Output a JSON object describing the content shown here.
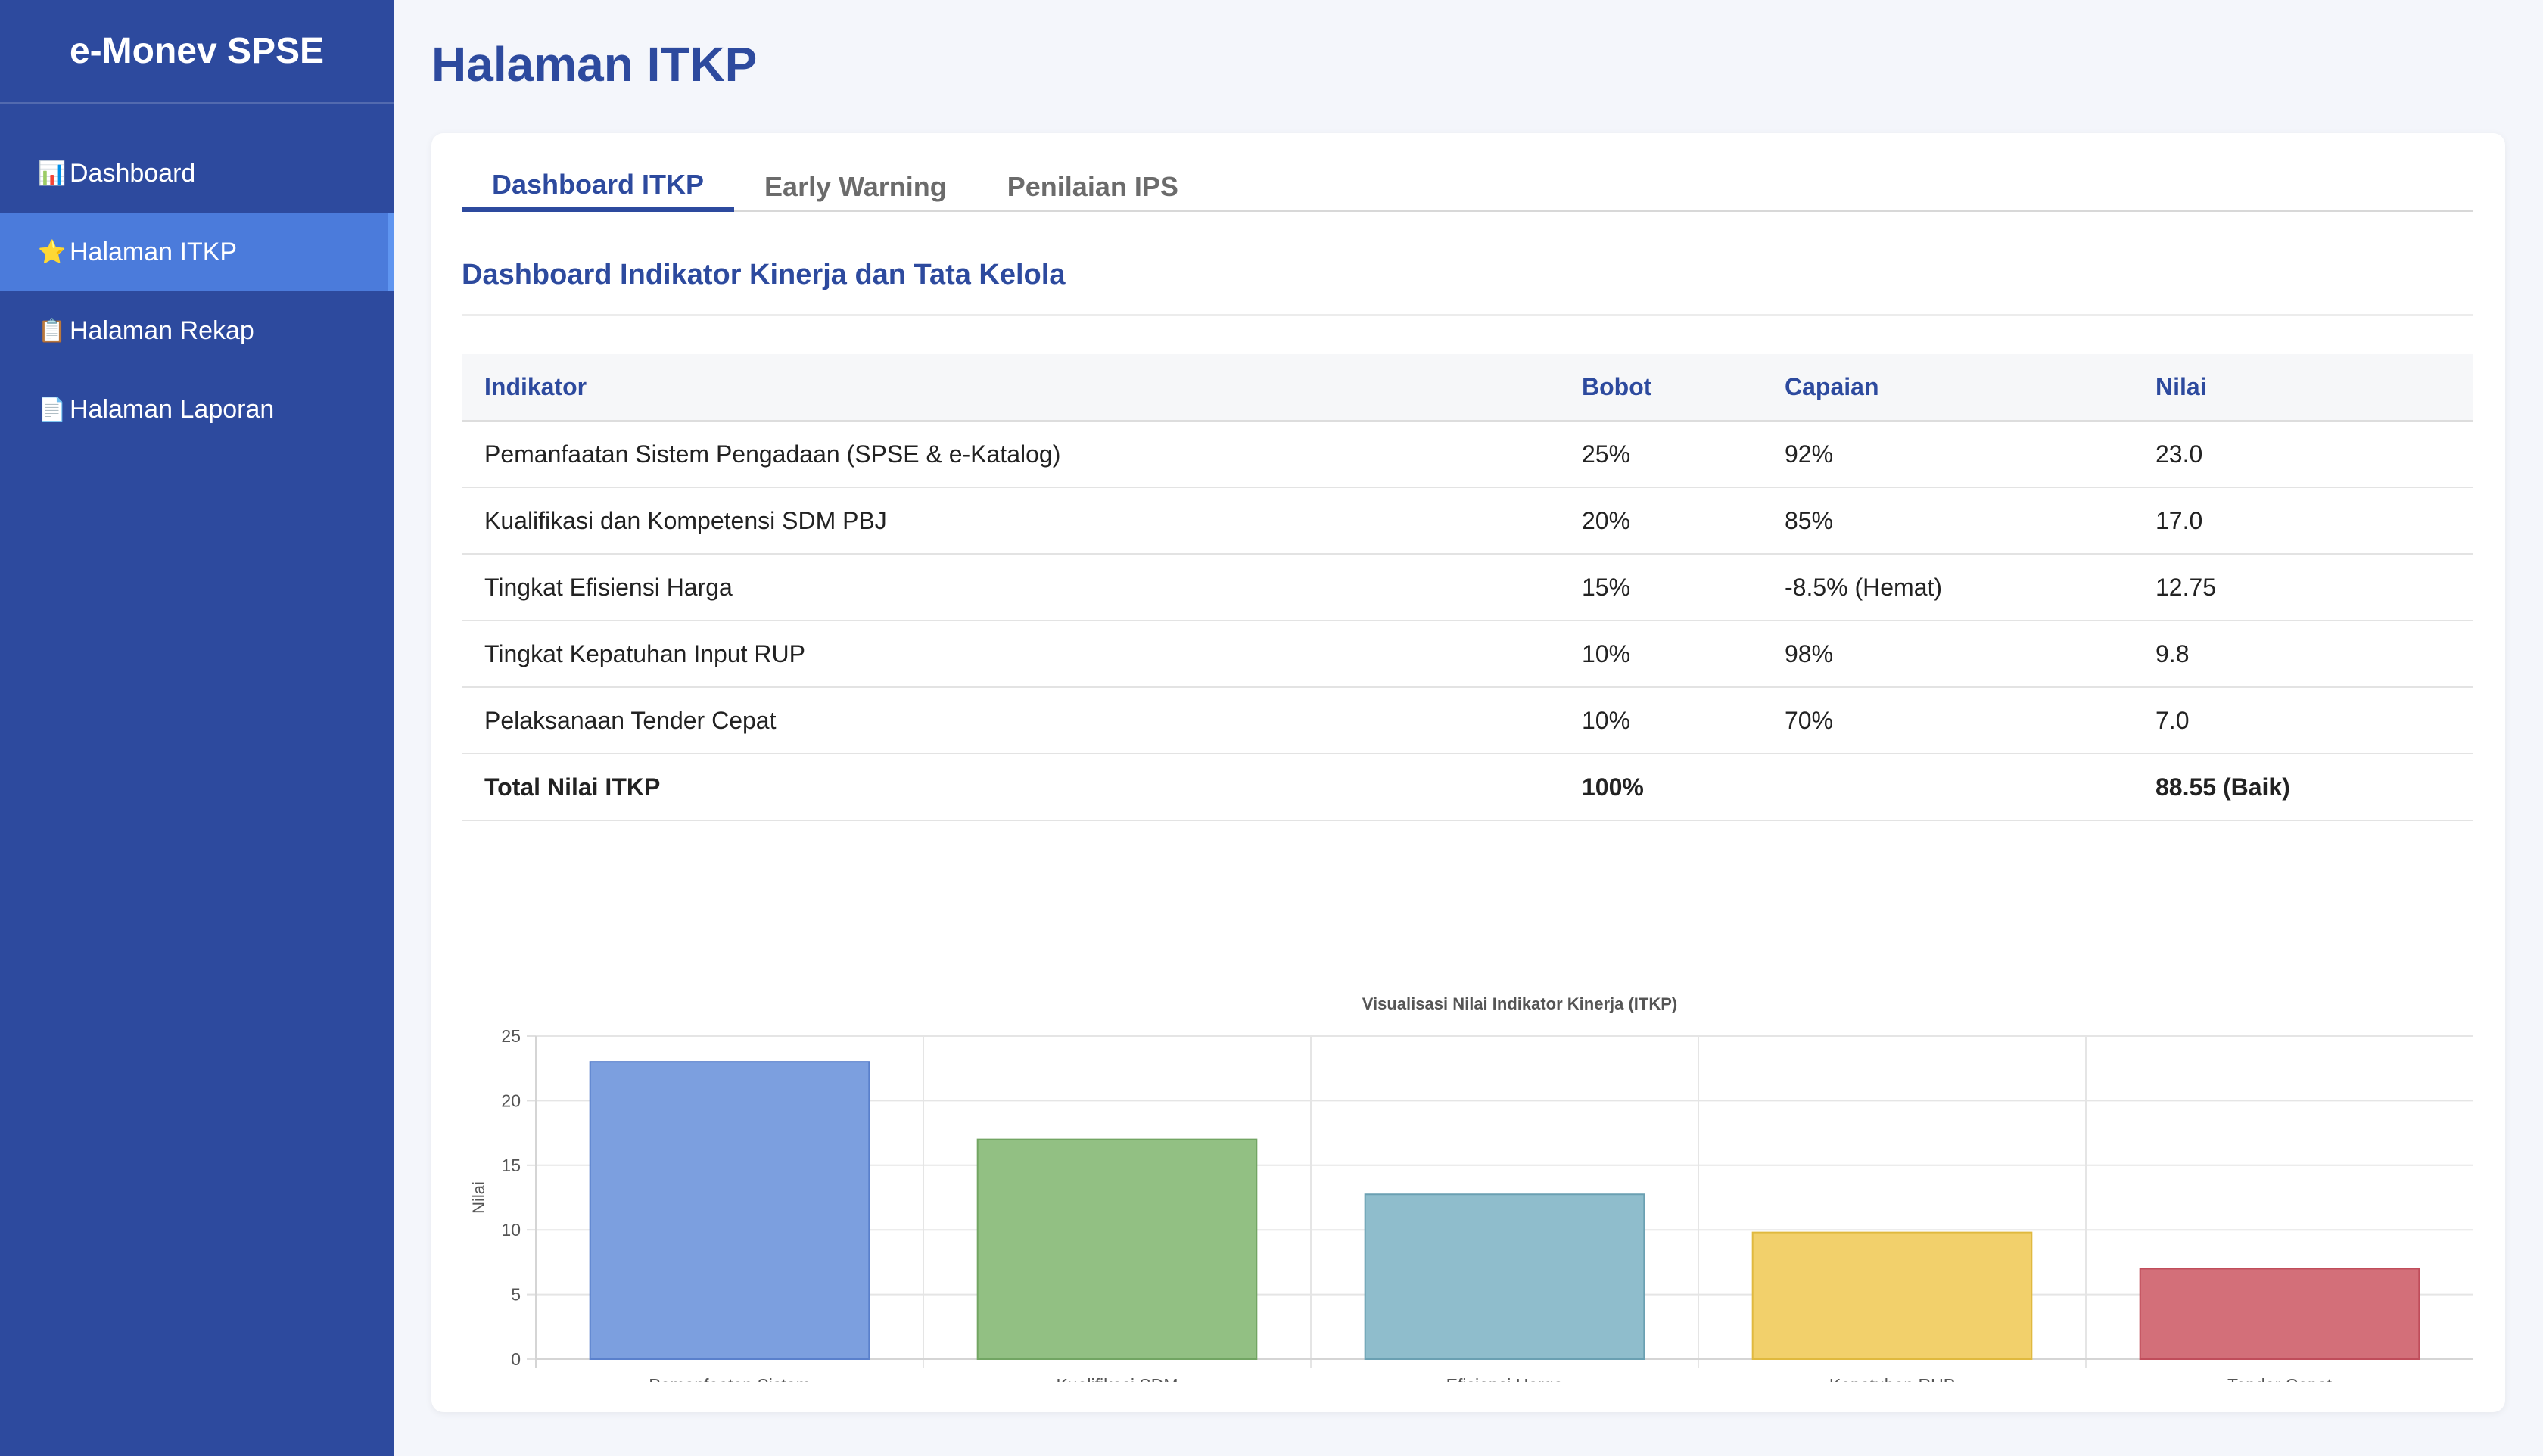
{
  "app": {
    "brand": "e-Monev SPSE"
  },
  "sidebar": {
    "items": [
      {
        "icon": "📊",
        "icon_name": "bar-chart-icon",
        "label": "Dashboard",
        "active": false
      },
      {
        "icon": "⭐",
        "icon_name": "star-icon",
        "label": "Halaman ITKP",
        "active": true
      },
      {
        "icon": "📋",
        "icon_name": "clipboard-icon",
        "label": "Halaman Rekap",
        "active": false
      },
      {
        "icon": "📄",
        "icon_name": "document-icon",
        "label": "Halaman Laporan",
        "active": false
      }
    ]
  },
  "page": {
    "title": "Halaman ITKP"
  },
  "tabs": [
    {
      "label": "Dashboard ITKP",
      "active": true
    },
    {
      "label": "Early Warning",
      "active": false
    },
    {
      "label": "Penilaian IPS",
      "active": false
    }
  ],
  "section": {
    "title": "Dashboard Indikator Kinerja dan Tata Kelola"
  },
  "table": {
    "headers": [
      "Indikator",
      "Bobot",
      "Capaian",
      "Nilai"
    ],
    "rows": [
      [
        "Pemanfaatan Sistem Pengadaan (SPSE & e-Katalog)",
        "25%",
        "92%",
        "23.0"
      ],
      [
        "Kualifikasi dan Kompetensi SDM PBJ",
        "20%",
        "85%",
        "17.0"
      ],
      [
        "Tingkat Efisiensi Harga",
        "15%",
        "-8.5% (Hemat)",
        "12.75"
      ],
      [
        "Tingkat Kepatuhan Input RUP",
        "10%",
        "98%",
        "9.8"
      ],
      [
        "Pelaksanaan Tender Cepat",
        "10%",
        "70%",
        "7.0"
      ]
    ],
    "total": [
      "Total Nilai ITKP",
      "100%",
      "",
      "88.55 (Baik)"
    ]
  },
  "colors": {
    "primary": "#2d4a9e",
    "sidebar_active": "#4b7bdb"
  },
  "chart_data": {
    "type": "bar",
    "title": "Visualisasi Nilai Indikator Kinerja (ITKP)",
    "categories": [
      "Pemanfaatan Sistem",
      "Kualifikasi SDM",
      "Efisiensi Harga",
      "Kepatuhan RUP",
      "Tender Cepat"
    ],
    "values": [
      23.0,
      17.0,
      12.75,
      9.8,
      7.0
    ],
    "colors": [
      "#7c9fdf",
      "#92c083",
      "#8fbdcc",
      "#f2d06b",
      "#d36f79"
    ],
    "border_colors": [
      "#5a80cc",
      "#72a563",
      "#6ba0b2",
      "#e0b93f",
      "#c04d5b"
    ],
    "ylabel": "Nilai",
    "xlabel": "",
    "ylim": [
      0,
      25
    ],
    "yticks": [
      0,
      5,
      10,
      15,
      20,
      25
    ],
    "grid": true
  }
}
